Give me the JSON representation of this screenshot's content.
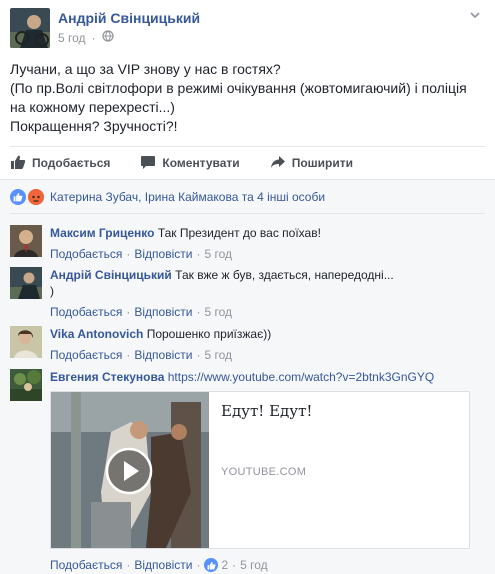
{
  "post": {
    "author": "Андрій Свінцицький",
    "time": "5 год",
    "text_lines": [
      "Лучани, а що за VIP знову у нас в гостях?",
      "(По пр.Волі світлофори в режимі очікування (жовтомигаючий) і поліція",
      "на кожному перехресті...)",
      "Покращення? Зручності?!"
    ]
  },
  "actions": {
    "like": "Подобається",
    "comment": "Коментувати",
    "share": "Поширити"
  },
  "reactions": {
    "text": "Катерина Зубач, Ірина Каймакова та 4 інші особи"
  },
  "comments": [
    {
      "name": "Максим Гриценко",
      "text": "Так Президент до вас поїхав!",
      "like": "Подобається",
      "reply": "Відповісти",
      "time": "5 год"
    },
    {
      "name": "Андрій Свінцицький",
      "text": "Так вже ж був, здається, напередодні...",
      "text2": ")",
      "like": "Подобається",
      "reply": "Відповісти",
      "time": "5 год"
    },
    {
      "name": "Vika Antonovich",
      "text": "Порошенко приїзжає))",
      "like": "Подобається",
      "reply": "Відповісти",
      "time": "5 год"
    },
    {
      "name": "Евгения Стекунова",
      "url": "https://www.youtube.com/watch?v=2btnk3GnGYQ",
      "preview_title": "Едут! Едут!",
      "preview_domain": "YOUTUBE.COM",
      "like": "Подобається",
      "reply": "Відповісти",
      "like_count": "2",
      "time": "5 год"
    }
  ],
  "colors": {
    "link": "#365899",
    "meta": "#90949c",
    "like_blue": "#5890ff",
    "angry": "#f0663a"
  }
}
